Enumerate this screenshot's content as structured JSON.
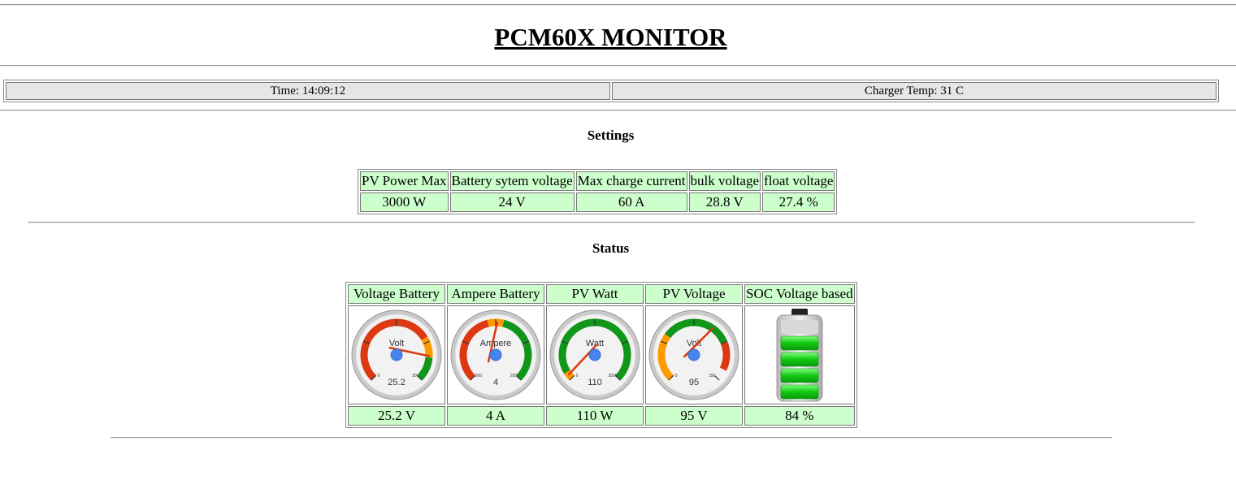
{
  "title": "PCM60X MONITOR",
  "topbar": {
    "time": "Time: 14:09:12",
    "temp": "Charger Temp: 31 C"
  },
  "settings": {
    "heading": "Settings",
    "headers": [
      "PV Power Max",
      "Battery sytem voltage",
      "Max charge current",
      "bulk voltage",
      "float voltage"
    ],
    "values": [
      "3000 W",
      "24 V",
      "60 A",
      "28.8 V",
      "27.4 %"
    ]
  },
  "status": {
    "heading": "Status",
    "headers": [
      "Voltage Battery",
      "Ampere Battery",
      "PV Watt",
      "PV Voltage",
      "SOC Voltage based"
    ],
    "values": [
      "25.2 V",
      "4 A",
      "110 W",
      "95 V",
      "84 %"
    ],
    "gauges": [
      {
        "unit": "Volt",
        "min": "0",
        "max": "30",
        "value": "25.2",
        "fraction": 0.84
      },
      {
        "unit": "Ampere",
        "min": "-200",
        "max": "200",
        "value": "4",
        "fraction": 0.51
      },
      {
        "unit": "Watt",
        "min": "0",
        "max": "3500",
        "value": "110",
        "fraction": 0.03
      },
      {
        "unit": "Volt",
        "min": "0",
        "max": "150",
        "value": "95",
        "fraction": 0.63
      }
    ],
    "battery_level": 0.84
  },
  "colors": {
    "cell_green": "#ccffcc",
    "gauge_red": "#dc3912",
    "gauge_orange": "#ff9900",
    "gauge_green": "#109618",
    "needle": "#dc3912",
    "hub": "#4684ee"
  }
}
